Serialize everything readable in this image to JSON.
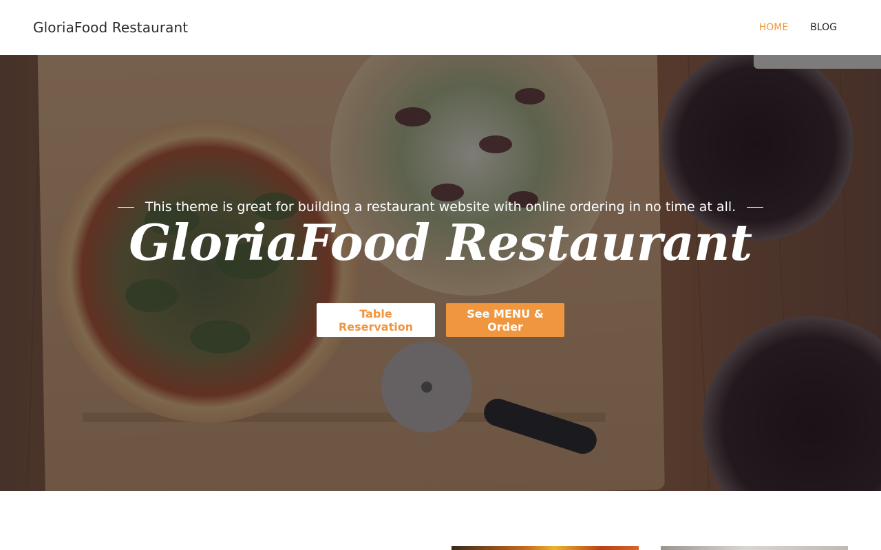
{
  "header": {
    "brand": "GloriaFood Restaurant",
    "nav": [
      {
        "label": "HOME",
        "active": true
      },
      {
        "label": "BLOG",
        "active": false
      }
    ]
  },
  "hero": {
    "tagline": "This theme is great for building a restaurant website with online ordering in no time at all.",
    "title": "GloriaFood Restaurant",
    "buttons": {
      "reservation": "Table Reservation",
      "order": "See MENU & Order"
    }
  },
  "colors": {
    "accent": "#f0963f",
    "header_bg": "#ffffff",
    "hero_overlay": "#1c161e"
  }
}
